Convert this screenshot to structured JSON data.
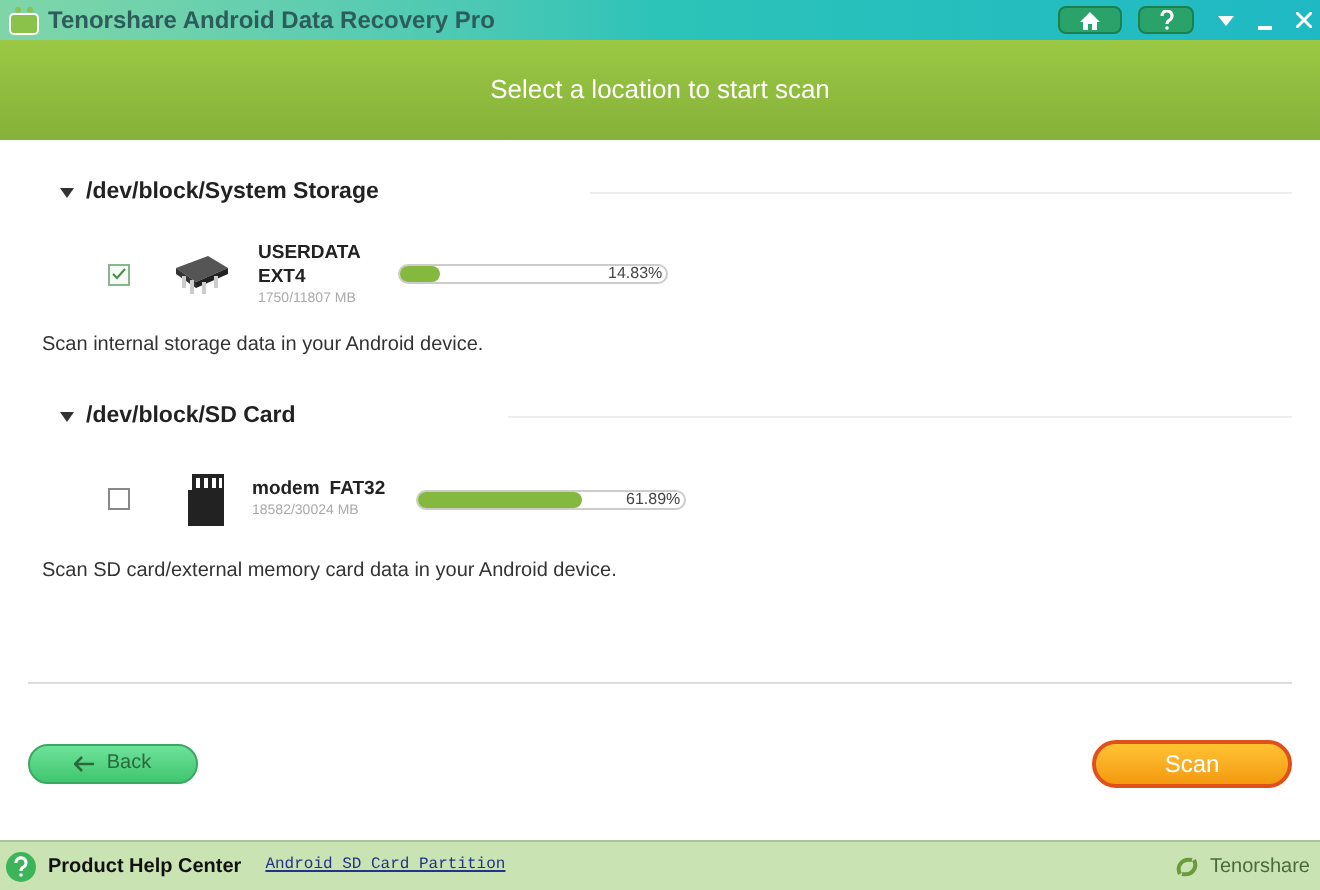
{
  "window": {
    "title": "Tenorshare Android Data Recovery Pro"
  },
  "header": {
    "title": "Select a location to start scan"
  },
  "sections": [
    {
      "path": "/dev/block/System Storage",
      "expanded": true,
      "device": {
        "kind": "chip",
        "checked": true,
        "name": "USERDATA",
        "fs": "EXT4",
        "size": "1750/11807 MB",
        "level": 0.1483,
        "reading": "14.83%"
      },
      "description": "Scan internal storage data in your Android device."
    },
    {
      "path": "/dev/block/SD Card",
      "expanded": true,
      "device": {
        "kind": "sdcard",
        "checked": false,
        "name": "modem",
        "fs": "FAT32",
        "size": "18582/30024 MB",
        "level": 0.6189,
        "reading": "61.89%"
      },
      "description": "Scan SD card/external memory card data in your Android device."
    }
  ],
  "buttons": {
    "back": "Back",
    "scan": "Scan"
  },
  "footer": {
    "help": "Product Help Center",
    "link": "Android SD Card Partition",
    "brand": "Tenorshare"
  }
}
